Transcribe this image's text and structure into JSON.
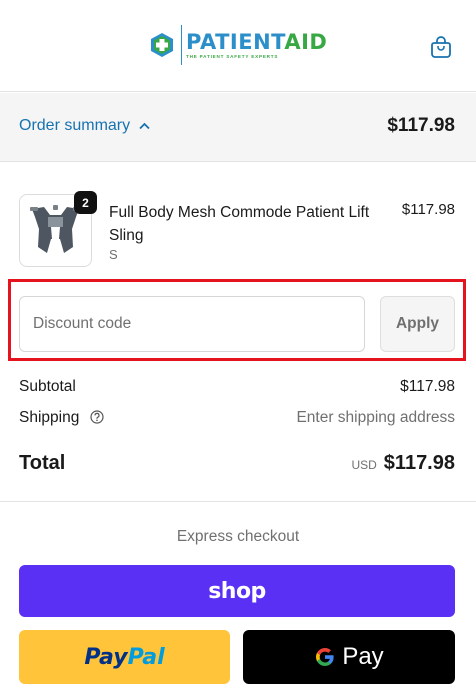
{
  "header": {
    "brand_part1": "PATIENT",
    "brand_part2": "AID",
    "brand_tagline": "THE PATIENT SAFETY EXPERTS",
    "cart_icon": "shopping-bag-icon"
  },
  "summary": {
    "toggle_label": "Order summary",
    "toggle_icon": "chevron-up-icon",
    "total": "$117.98"
  },
  "product": {
    "name": "Full Body Mesh Commode Patient Lift Sling",
    "variant": "S",
    "quantity": "2",
    "price": "$117.98"
  },
  "discount": {
    "placeholder": "Discount code",
    "value": "",
    "apply_label": "Apply"
  },
  "totals": {
    "subtotal_label": "Subtotal",
    "subtotal_value": "$117.98",
    "shipping_label": "Shipping",
    "shipping_value": "Enter shipping address",
    "total_label": "Total",
    "currency": "USD",
    "total_value": "$117.98"
  },
  "express": {
    "heading": "Express checkout",
    "shop_label": "shop",
    "paypal_part1": "Pay",
    "paypal_part2": "Pal",
    "gpay_label": "Pay"
  },
  "colors": {
    "link": "#1773b0",
    "shop_purple": "#5a31f4",
    "paypal_yellow": "#ffc439",
    "highlight_red": "#e5131d",
    "brand_blue": "#2c8fc9",
    "brand_green": "#38a845"
  }
}
